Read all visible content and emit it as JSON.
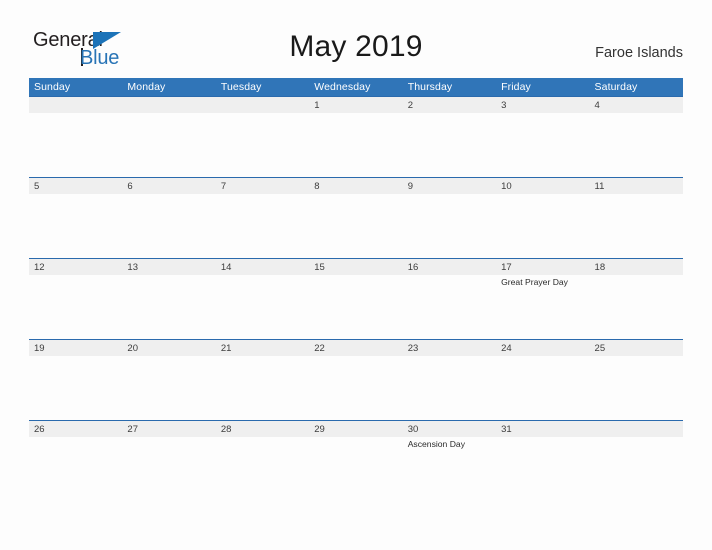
{
  "brand": {
    "name_part1": "General",
    "name_part2": "Blue",
    "triangle_icon": "brand-triangle-icon",
    "accent_color": "#1c73b8"
  },
  "header": {
    "title": "May 2019",
    "region": "Faroe Islands"
  },
  "theme": {
    "header_blue": "#3075b8",
    "rule_blue": "#2a6aad",
    "number_band": "#efefef",
    "page_background": "#fdfdfd"
  },
  "calendar": {
    "month": "May",
    "year": "2019",
    "weekday_headers": [
      "Sunday",
      "Monday",
      "Tuesday",
      "Wednesday",
      "Thursday",
      "Friday",
      "Saturday"
    ],
    "weeks": [
      {
        "days": [
          {
            "number": "",
            "events": []
          },
          {
            "number": "",
            "events": []
          },
          {
            "number": "",
            "events": []
          },
          {
            "number": "1",
            "events": []
          },
          {
            "number": "2",
            "events": []
          },
          {
            "number": "3",
            "events": []
          },
          {
            "number": "4",
            "events": []
          }
        ]
      },
      {
        "days": [
          {
            "number": "5",
            "events": []
          },
          {
            "number": "6",
            "events": []
          },
          {
            "number": "7",
            "events": []
          },
          {
            "number": "8",
            "events": []
          },
          {
            "number": "9",
            "events": []
          },
          {
            "number": "10",
            "events": []
          },
          {
            "number": "11",
            "events": []
          }
        ]
      },
      {
        "days": [
          {
            "number": "12",
            "events": []
          },
          {
            "number": "13",
            "events": []
          },
          {
            "number": "14",
            "events": []
          },
          {
            "number": "15",
            "events": []
          },
          {
            "number": "16",
            "events": []
          },
          {
            "number": "17",
            "events": [
              "Great Prayer Day"
            ]
          },
          {
            "number": "18",
            "events": []
          }
        ]
      },
      {
        "days": [
          {
            "number": "19",
            "events": []
          },
          {
            "number": "20",
            "events": []
          },
          {
            "number": "21",
            "events": []
          },
          {
            "number": "22",
            "events": []
          },
          {
            "number": "23",
            "events": []
          },
          {
            "number": "24",
            "events": []
          },
          {
            "number": "25",
            "events": []
          }
        ]
      },
      {
        "days": [
          {
            "number": "26",
            "events": []
          },
          {
            "number": "27",
            "events": []
          },
          {
            "number": "28",
            "events": []
          },
          {
            "number": "29",
            "events": []
          },
          {
            "number": "30",
            "events": [
              "Ascension Day"
            ]
          },
          {
            "number": "31",
            "events": []
          },
          {
            "number": "",
            "events": []
          }
        ]
      }
    ]
  }
}
